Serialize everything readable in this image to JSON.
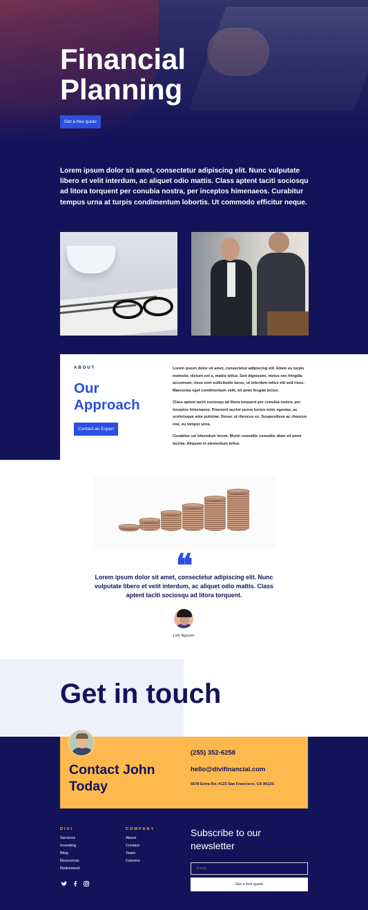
{
  "hero": {
    "title": "Financial Planning",
    "button": "Get a free quote"
  },
  "intro": {
    "text": "Lorem ipsum dolor sit amet, consectetur adipiscing elit. Nunc vulputate libero et velit interdum, ac aliquet odio mattis. Class aptent taciti sociosqu ad litora torquent per conubia nostra, per inceptos himenaeos. Curabitur tempus urna at turpis condimentum lobortis. Ut commodo efficitur neque."
  },
  "about": {
    "eyebrow": "ABOUT",
    "title": "Our Approach",
    "button": "Contact an Expert",
    "paragraphs": [
      "Lorem ipsum dolor sit amet, consectetur adipiscing elit. Etiam eu turpis molestie, dictum est a, mattis tellus. Sed dignissim, metus nec fringilla accumsan, risus sem sollicitudin lacus, ut interdum tellus elit sed risus. Maecenas eget condimentum velit, sit amet feugiat lectus.",
      "Class aptent taciti sociosqu ad litora torquent per conubia nostra, per inceptos himenaeos. Praesent auctor purus luctus enim egestas, ac scelerisque ante pulvinar. Donec ut rhoncus ex. Suspendisse ac rhoncus nisl, eu tempor urna.",
      "Curabitur vel bibendum lorem. Morbi convallis convallis diam sit amet lacinia. Aliquam in elementum tellus."
    ]
  },
  "testimonial": {
    "quote": "Lorem ipsum dolor sit amet, consectetur adipiscing elit. Nunc vulputate libero et velit interdum, ac aliquet odio mattis. Class aptent taciti sociosqu ad litora torquent.",
    "name": "Linh Nguyen"
  },
  "contact": {
    "heading": "Get in touch",
    "card_title": "Contact John Today",
    "phone": "(255) 352-6258",
    "email": "hello@divifinancial.com",
    "address": "5678 Extra Rd. #123 San Francisco, CA 96120."
  },
  "footer": {
    "col1": {
      "heading": "DIVI",
      "links": [
        "Services",
        "Investing",
        "Blog",
        "Resources",
        "Retirement"
      ]
    },
    "col2": {
      "heading": "COMPANY",
      "links": [
        "About",
        "Contact",
        "Team",
        "Careers"
      ]
    },
    "social": [
      "twitter-icon",
      "facebook-icon",
      "instagram-icon"
    ],
    "newsletter": {
      "title": "Subscribe to our newsletter",
      "placeholder": "Email",
      "button": "Get a free quote"
    }
  },
  "colors": {
    "navy": "#13135a",
    "blue": "#2b4fe0",
    "yellow": "#fdb94e",
    "light": "#eef1fa"
  }
}
